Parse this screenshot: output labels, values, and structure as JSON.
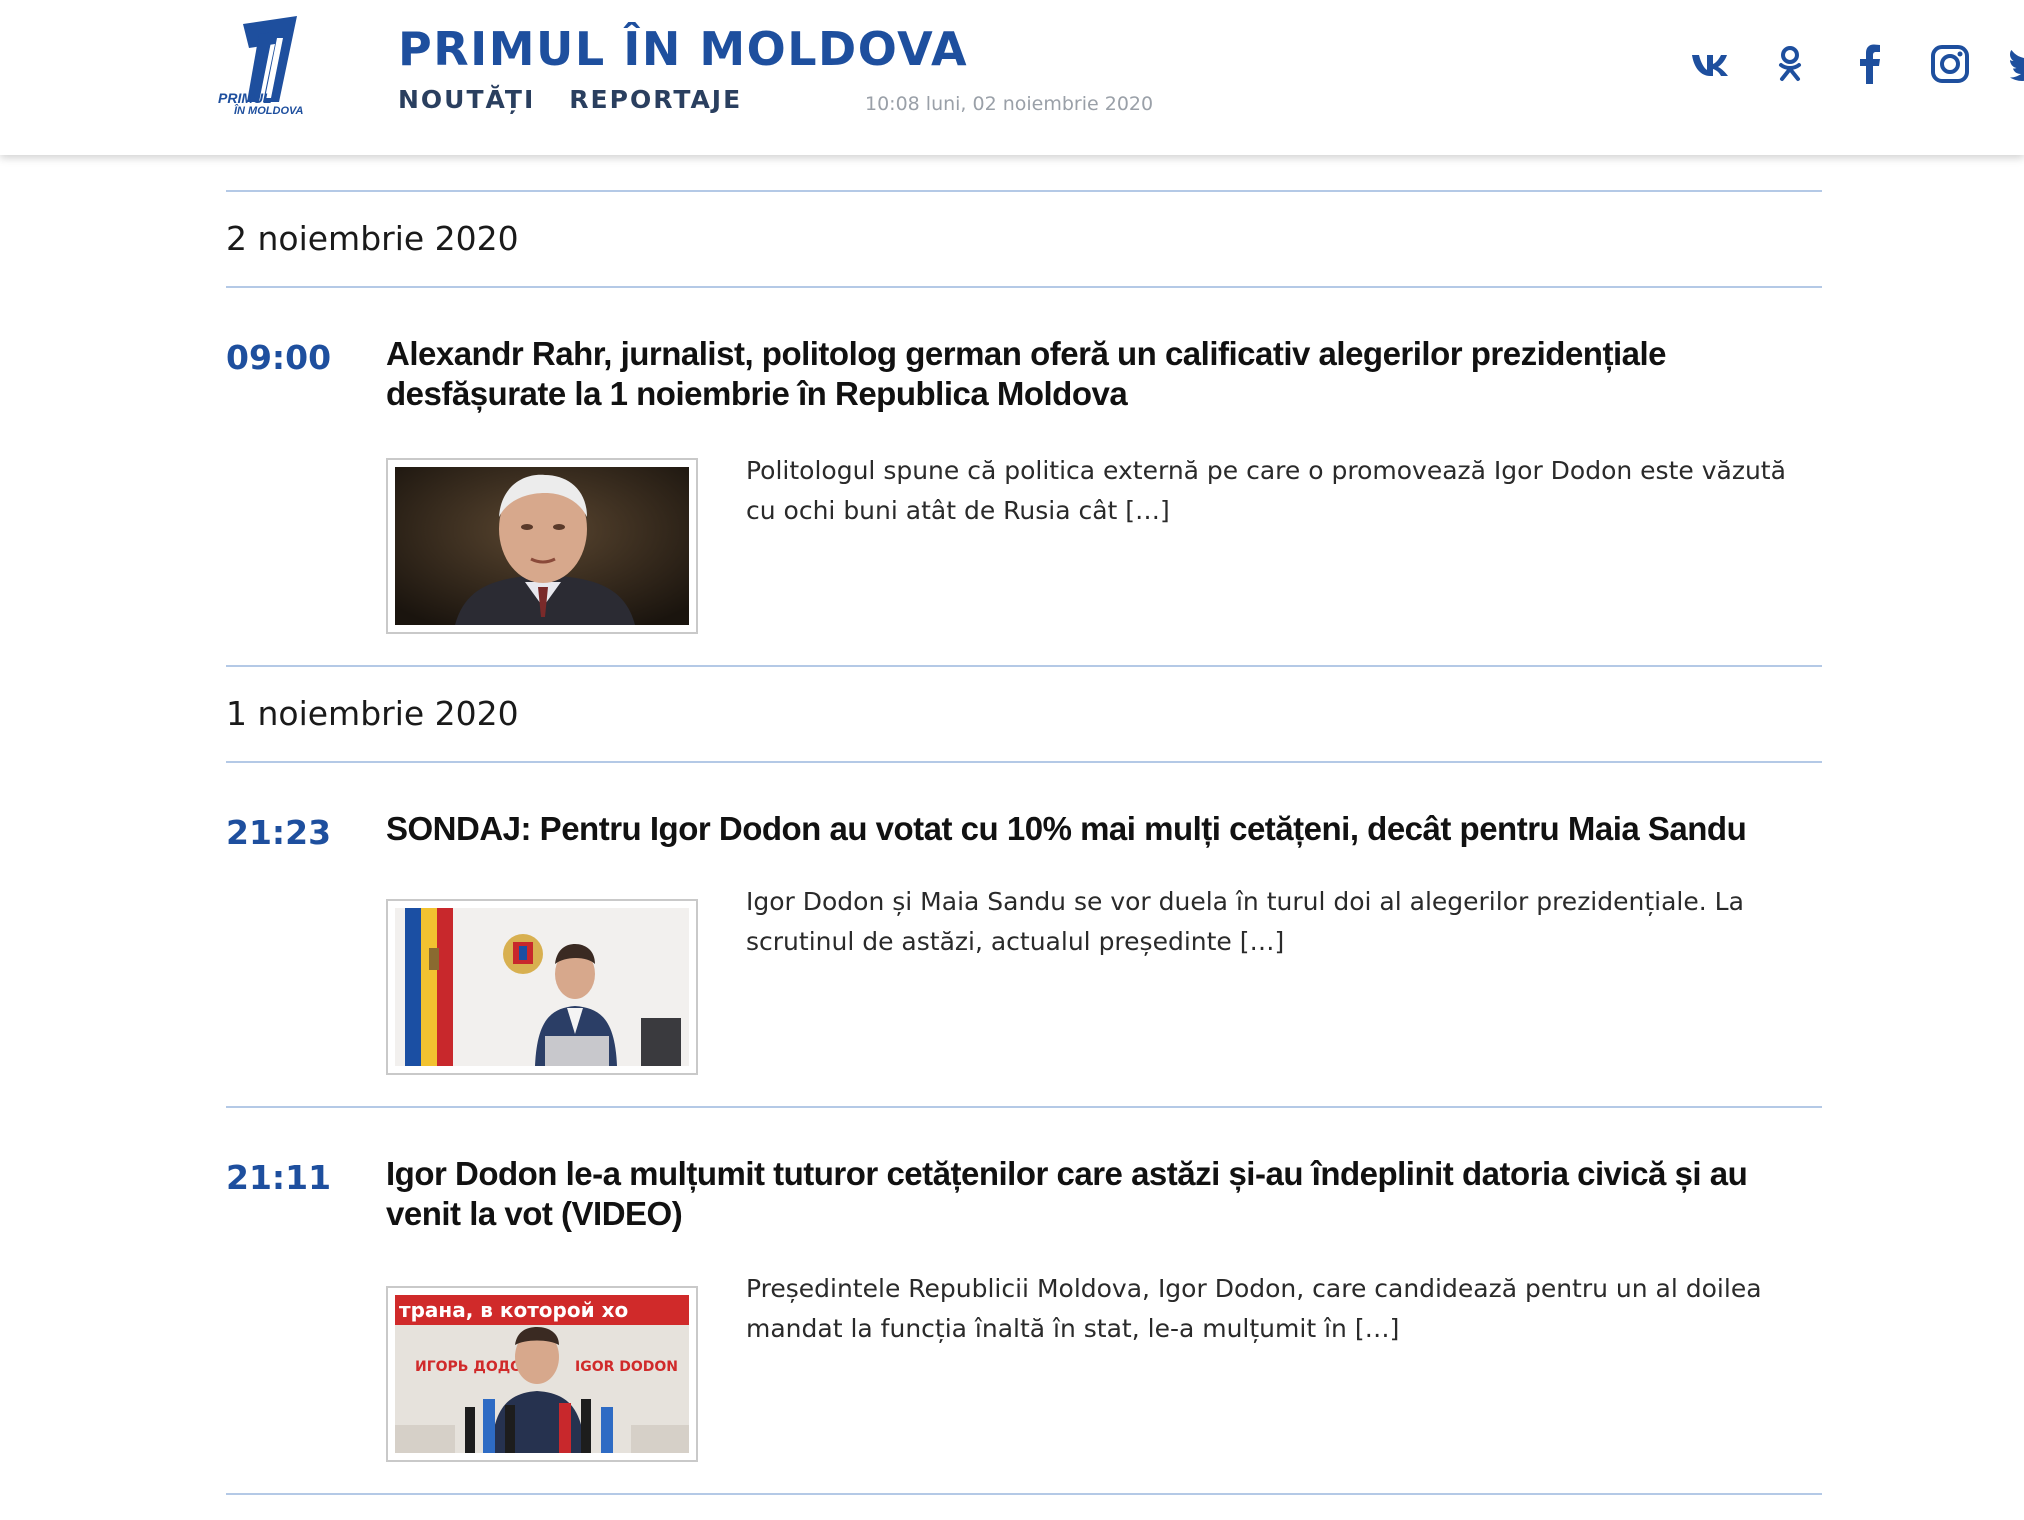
{
  "header": {
    "logo_text_line1": "PRIMUL",
    "logo_text_line2": "ÎN MOLDOVA",
    "site_title": "PRIMUL ÎN MOLDOVA",
    "nav": [
      "NOUTĂȚI",
      "REPORTAJE"
    ],
    "datetime": "10:08 luni, 02 noiembrie 2020",
    "socials": [
      "vk-icon",
      "odnoklassniki-icon",
      "facebook-icon",
      "instagram-icon",
      "twitter-icon"
    ],
    "accent_color": "#1e4f9e"
  },
  "days": [
    {
      "label": "2 noiembrie 2020",
      "articles": [
        {
          "time": "09:00",
          "title": "Alexandr Rahr, jurnalist, politolog german oferă un calificativ alegerilor prezidențiale desfășurate la 1 noiembrie în Republica Moldova",
          "excerpt": "Politologul spune că politica externă pe care o promovează Igor Dodon este văzută cu ochi buni atât de Rusia cât […]"
        }
      ]
    },
    {
      "label": "1 noiembrie 2020",
      "articles": [
        {
          "time": "21:23",
          "title": "SONDAJ: Pentru Igor Dodon au votat cu 10% mai mulți cetățeni, decât pentru Maia Sandu",
          "excerpt": "Igor Dodon și Maia Sandu se vor duela în turul doi al alegerilor prezidențiale. La scrutinul de astăzi, actualul președinte […]"
        },
        {
          "time": "21:11",
          "title": "Igor Dodon le-a mulțumit tuturor cetățenilor care astăzi și-au îndeplinit datoria civică și au venit la vot (VIDEO)",
          "excerpt": "Președintele Republicii Moldova, Igor Dodon, care candidează pentru un al doilea mandat la funcția înaltă în stat, le-a mulțumit în […]",
          "thumb_text_top": "трана, в которой хо",
          "thumb_text_left": "ИГОРЬ ДОДОН",
          "thumb_text_right": "IGOR DODON"
        }
      ]
    }
  ]
}
